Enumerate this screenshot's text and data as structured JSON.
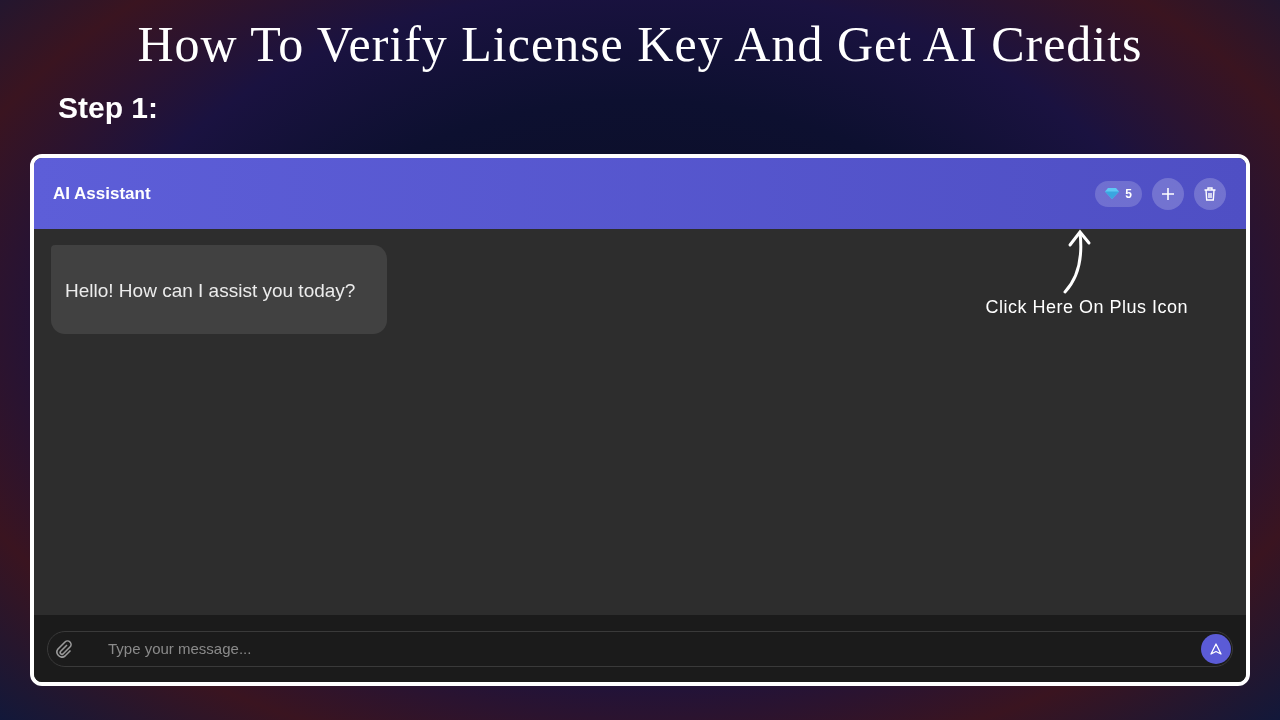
{
  "title": "How To Verify License Key And Get AI Credits",
  "step": "Step 1:",
  "window": {
    "title": "AI Assistant",
    "credits": "5"
  },
  "messages": [
    {
      "text": "Hello! How can I assist you today?"
    }
  ],
  "annotation": {
    "text": "Click Here On Plus Icon"
  },
  "composer": {
    "placeholder": "Type your message..."
  }
}
